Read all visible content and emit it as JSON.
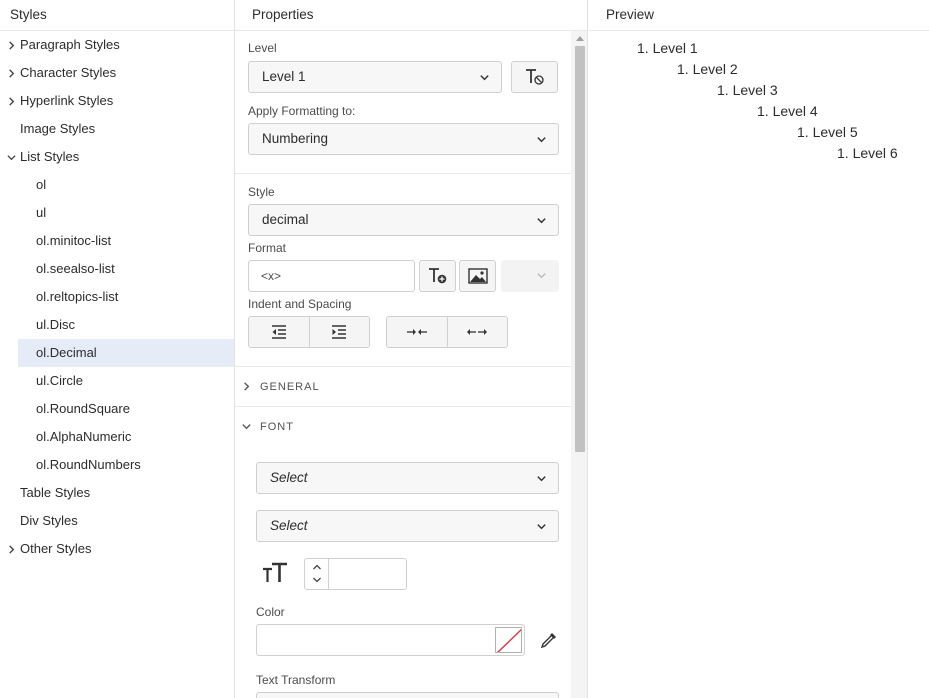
{
  "styles_pane": {
    "title": "Styles",
    "items": [
      {
        "label": "Paragraph Styles",
        "expandable": true,
        "expanded": false
      },
      {
        "label": "Character Styles",
        "expandable": true,
        "expanded": false
      },
      {
        "label": "Hyperlink Styles",
        "expandable": true,
        "expanded": false
      },
      {
        "label": "Image Styles",
        "expandable": false
      },
      {
        "label": "List Styles",
        "expandable": true,
        "expanded": true
      },
      {
        "label": "Table Styles",
        "expandable": false
      },
      {
        "label": "Div Styles",
        "expandable": false
      },
      {
        "label": "Other Styles",
        "expandable": true,
        "expanded": false
      }
    ],
    "list_children": [
      "ol",
      "ul",
      "ol.minitoc-list",
      "ol.seealso-list",
      "ol.reltopics-list",
      "ul.Disc",
      "ol.Decimal",
      "ul.Circle",
      "ol.RoundSquare",
      "ol.AlphaNumeric",
      "ol.RoundNumbers"
    ],
    "selected": "ol.Decimal",
    "selected_color": "#e5ecf7"
  },
  "properties": {
    "title": "Properties",
    "level_label": "Level",
    "level_value": "Level 1",
    "apply_label": "Apply Formatting to:",
    "apply_value": "Numbering",
    "style_label": "Style",
    "style_value": "decimal",
    "format_label": "Format",
    "format_value": "<x>",
    "indent_label": "Indent and Spacing",
    "general_label": "GENERAL",
    "font_label": "FONT",
    "font_family_placeholder": "Select",
    "font_weight_placeholder": "Select",
    "color_label": "Color",
    "text_transform_label": "Text Transform"
  },
  "preview": {
    "title": "Preview",
    "lines": [
      "1. Level 1",
      "1. Level 2",
      "1. Level 3",
      "1. Level 4",
      "1. Level 5",
      "1. Level 6"
    ]
  },
  "icons": [
    "chevron-right-icon",
    "chevron-down-icon",
    "clear-formatting-icon",
    "insert-text-variable-icon",
    "insert-image-icon",
    "decrease-indent-icon",
    "increase-indent-icon",
    "decrease-spacing-icon",
    "increase-spacing-icon",
    "font-size-icon",
    "eyedropper-icon"
  ],
  "colors": {
    "accent": "#e5ecf7",
    "border": "#d0d0d0",
    "no_color_slash": "#d7373f"
  }
}
